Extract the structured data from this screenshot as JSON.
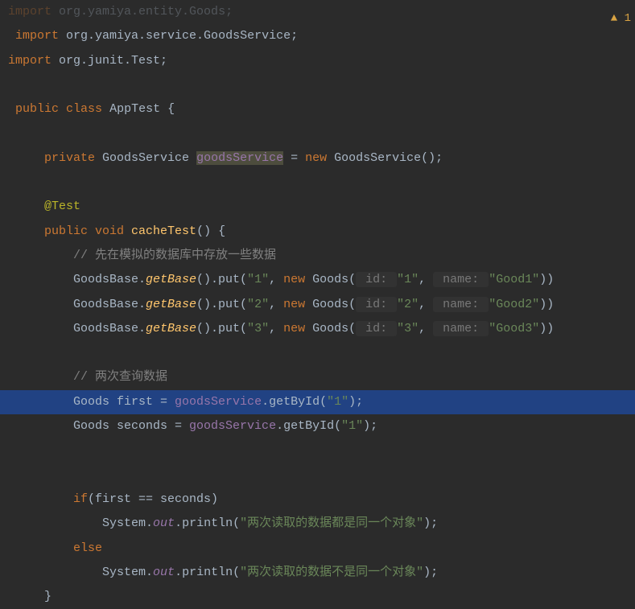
{
  "code": {
    "imports": {
      "line0": {
        "keyword": "import",
        "package": "org.yamiya.entity.Goods;"
      },
      "line1": {
        "keyword": "import",
        "package": " org.yamiya.service.GoodsService;"
      },
      "line2": {
        "keyword": "import",
        "package": " org.junit.Test;"
      }
    },
    "class_decl": {
      "public": "public",
      "class": "class",
      "name": "AppTest",
      "brace": " {"
    },
    "field_decl": {
      "private": "private",
      "type": " GoodsService ",
      "name": "goodsService",
      "assign": " = ",
      "new": "new",
      "ctor": " GoodsService();"
    },
    "annotation": "@Test",
    "method_decl": {
      "public": "public",
      "void": " void ",
      "name": "cacheTest",
      "params": "() {"
    },
    "comment1": "// 先在模拟的数据库中存放一些数据",
    "put1": {
      "base": "GoodsBase.",
      "getBase": "getBase",
      "put": "().put(",
      "arg1": "\"1\"",
      "comma": ", ",
      "new": "new",
      "goods": " Goods(",
      "hint_id": " id: ",
      "id_val": "\"1\"",
      "comma2": ", ",
      "hint_name": " name: ",
      "name_val": "\"Good1\"",
      "end": "))"
    },
    "put2": {
      "base": "GoodsBase.",
      "getBase": "getBase",
      "put": "().put(",
      "arg1": "\"2\"",
      "comma": ", ",
      "new": "new",
      "goods": " Goods(",
      "hint_id": " id: ",
      "id_val": "\"2\"",
      "comma2": ", ",
      "hint_name": " name: ",
      "name_val": "\"Good2\"",
      "end": "))"
    },
    "put3": {
      "base": "GoodsBase.",
      "getBase": "getBase",
      "put": "().put(",
      "arg1": "\"3\"",
      "comma": ", ",
      "new": "new",
      "goods": " Goods(",
      "hint_id": " id: ",
      "id_val": "\"3\"",
      "comma2": ", ",
      "hint_name": " name: ",
      "name_val": "\"Good3\"",
      "end": "))"
    },
    "comment2": "// 两次查询数据",
    "query1": {
      "type": "Goods first = ",
      "field": "goodsService",
      "method": ".getById(",
      "arg": "\"1\"",
      "end": ");"
    },
    "query2": {
      "type": "Goods seconds = ",
      "field": "goodsService",
      "method": ".getById(",
      "arg": "\"1\"",
      "end": ");"
    },
    "if_stmt": {
      "if": "if",
      "cond": "(first == seconds)"
    },
    "print1": {
      "sys": "System.",
      "out": "out",
      "println": ".println(",
      "str": "\"两次读取的数据都是同一个对象\"",
      "end": ");"
    },
    "else": "else",
    "print2": {
      "sys": "System.",
      "out": "out",
      "println": ".println(",
      "str": "\"两次读取的数据不是同一个对象\"",
      "end": ");"
    },
    "close_brace": "}"
  },
  "warning_count": "1"
}
